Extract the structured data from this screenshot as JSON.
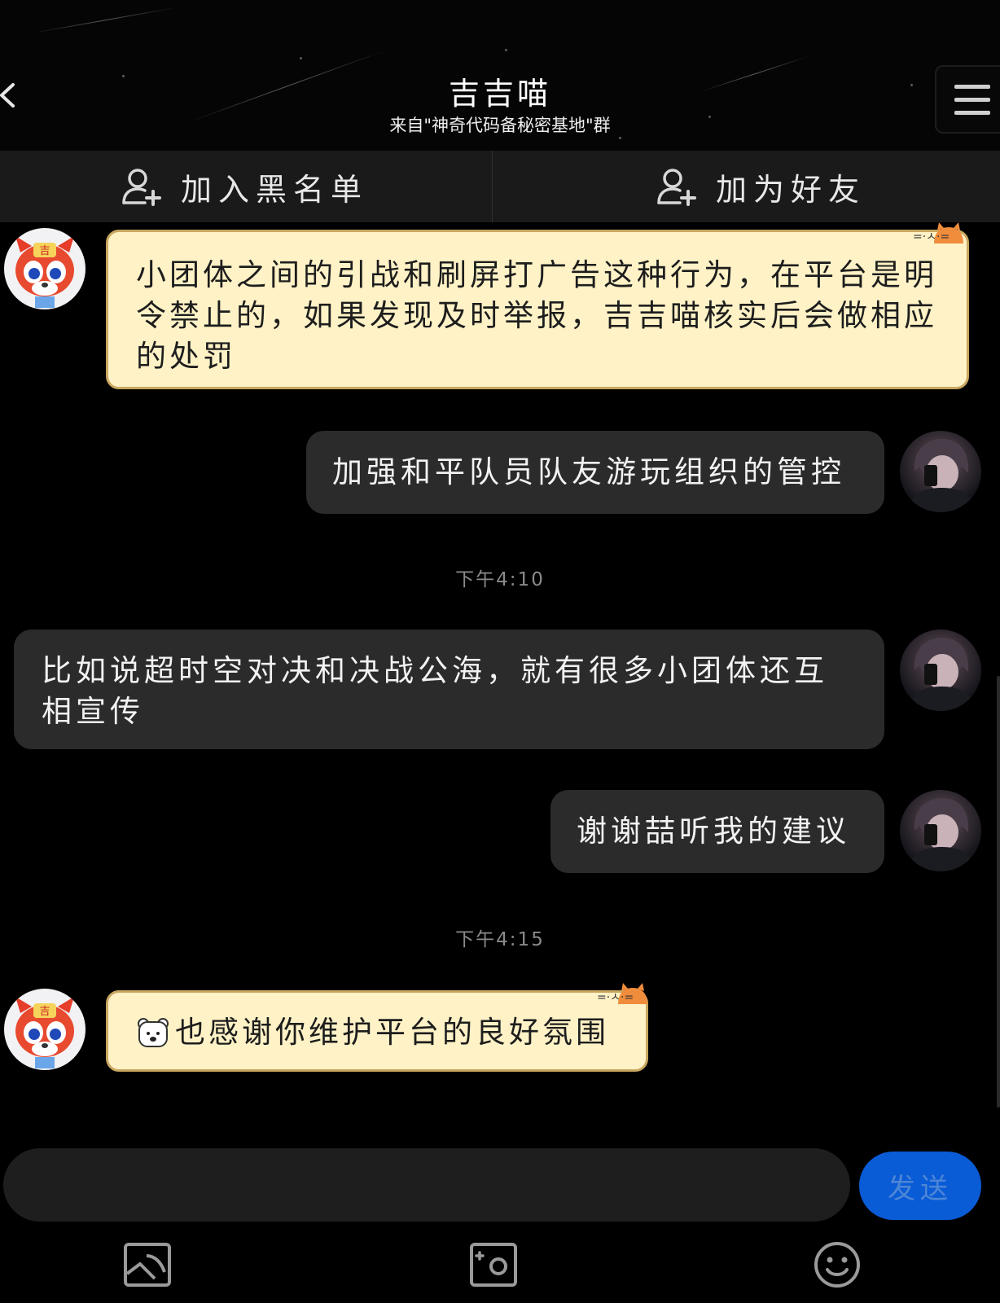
{
  "header": {
    "title": "吉吉喵",
    "subtitle": "来自\"神奇代码备秘密基地\"群",
    "back_icon": "chevron-left-icon",
    "menu_icon": "hamburger-menu-icon"
  },
  "actions": {
    "blacklist_label": "加入黑名单",
    "add_friend_label": "加为好友"
  },
  "messages": [
    {
      "sender": "吉吉喵",
      "text": "小团体之间的引战和刷屏打广告这种行为，在平台是明令禁止的，如果发现及时举报，吉吉喵核实后会做相应的处罚"
    },
    {
      "sender": "me",
      "text": "加强和平队员队友游玩组织的管控"
    },
    {
      "sender": "me",
      "text": "比如说超时空对决和决战公海，就有很多小团体还互相宣传"
    },
    {
      "sender": "me",
      "text": "谢谢喆听我的建议"
    },
    {
      "sender": "吉吉喵",
      "text": "也感谢你维护平台的良好氛围",
      "emoji": "polar-bear-emoji"
    }
  ],
  "timestamps": [
    "下午4:10",
    "下午4:15"
  ],
  "composer": {
    "input_value": "",
    "send_label": "发送"
  },
  "toolbar": [
    "image-icon",
    "camera-icon",
    "emoji-icon"
  ],
  "colors": {
    "background": "#000000",
    "cute_bubble": "#fff2c6",
    "dark_bubble": "#2b2b2b",
    "send_button": "#0a5bd6"
  }
}
